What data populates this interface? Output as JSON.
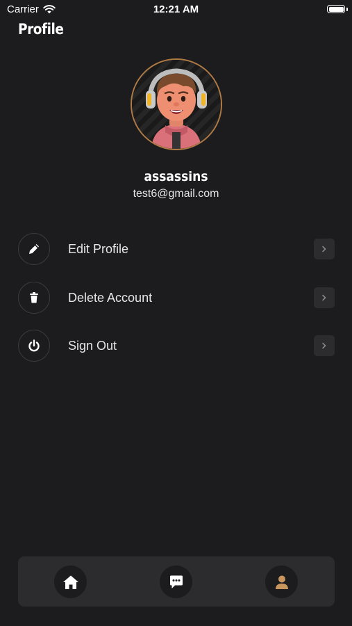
{
  "status": {
    "carrier": "Carrier",
    "time": "12:21 AM"
  },
  "header": {
    "title": "Profile"
  },
  "user": {
    "name": "assassins",
    "email": "test6@gmail.com"
  },
  "menu": [
    {
      "label": "Edit Profile",
      "icon": "pencil-icon"
    },
    {
      "label": "Delete Account",
      "icon": "trash-icon"
    },
    {
      "label": "Sign Out",
      "icon": "power-icon"
    }
  ],
  "tabbar": [
    {
      "icon": "home-icon"
    },
    {
      "icon": "chat-icon"
    },
    {
      "icon": "person-icon",
      "active": true
    }
  ],
  "colors": {
    "background": "#1c1c1e",
    "surface": "#2c2c2e",
    "accent": "#c8955f"
  }
}
